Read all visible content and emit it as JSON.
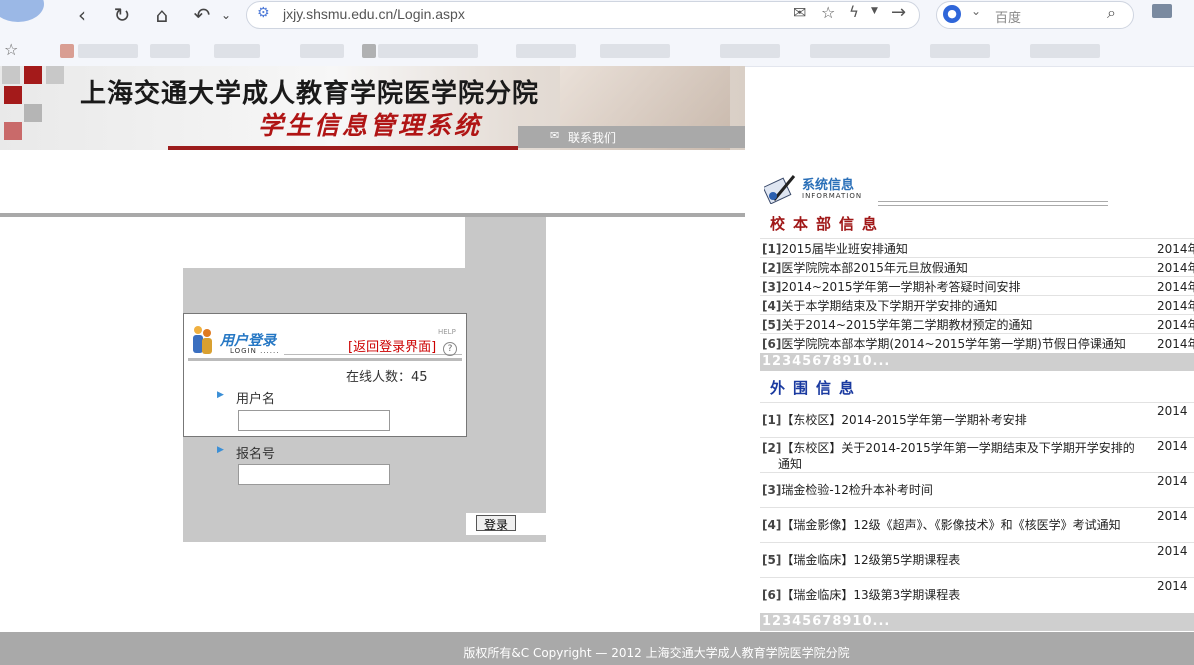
{
  "browser": {
    "url": "jxjy.shsmu.edu.cn/Login.aspx",
    "search_placeholder": "百度"
  },
  "banner": {
    "title": "上海交通大学成人教育学院医学院分院",
    "subtitle": "学生信息管理系统",
    "contact": "联系我们"
  },
  "login": {
    "heading": "用户登录",
    "heading_sub": "LOGIN ......",
    "help": "HELP",
    "link": "[返回登录界面]",
    "online": "在线人数：45",
    "username_label": "用户名",
    "regno_label": "报名号",
    "submit": "登录"
  },
  "info": {
    "title": "系统信息",
    "title_sub": "INFORMATION",
    "section1": "校本部信息",
    "section1_items": [
      {
        "num": "[1]",
        "text": "2015届毕业班安排通知",
        "date": "2014年"
      },
      {
        "num": "[2]",
        "text": "医学院院本部2015年元旦放假通知",
        "date": "2014年"
      },
      {
        "num": "[3]",
        "text": "2014~2015学年第一学期补考答疑时间安排",
        "date": "2014年"
      },
      {
        "num": "[4]",
        "text": "关于本学期结束及下学期开学安排的通知",
        "date": "2014年"
      },
      {
        "num": "[5]",
        "text": "关于2014~2015学年第二学期教材预定的通知",
        "date": "2014年"
      },
      {
        "num": "[6]",
        "text": "医学院院本部本学期(2014~2015学年第一学期)节假日停课通知",
        "date": "2014年"
      }
    ],
    "pager1": "12345678910...",
    "section2": "外围信息",
    "section2_items": [
      {
        "num": "[1]",
        "text": "【东校区】2014-2015学年第一学期补考安排",
        "text2": "",
        "date": "2014"
      },
      {
        "num": "[2]",
        "text": "【东校区】关于2014-2015学年第一学期结束及下学期开学安排的",
        "text2": "通知",
        "date": "2014"
      },
      {
        "num": "[3]",
        "text": "瑞金检验-12检升本补考时间",
        "text2": "",
        "date": "2014"
      },
      {
        "num": "[4]",
        "text": "【瑞金影像】12级《超声》、《影像技术》和《核医学》考试通知",
        "text2": "",
        "date": "2014"
      },
      {
        "num": "[5]",
        "text": "【瑞金临床】12级第5学期课程表",
        "text2": "",
        "date": "2014"
      },
      {
        "num": "[6]",
        "text": "【瑞金临床】13级第3学期课程表",
        "text2": "",
        "date": "2014"
      }
    ],
    "pager2": "12345678910..."
  },
  "footer": "版权所有&C Copyright — 2012 上海交通大学成人教育学院医学院分院"
}
